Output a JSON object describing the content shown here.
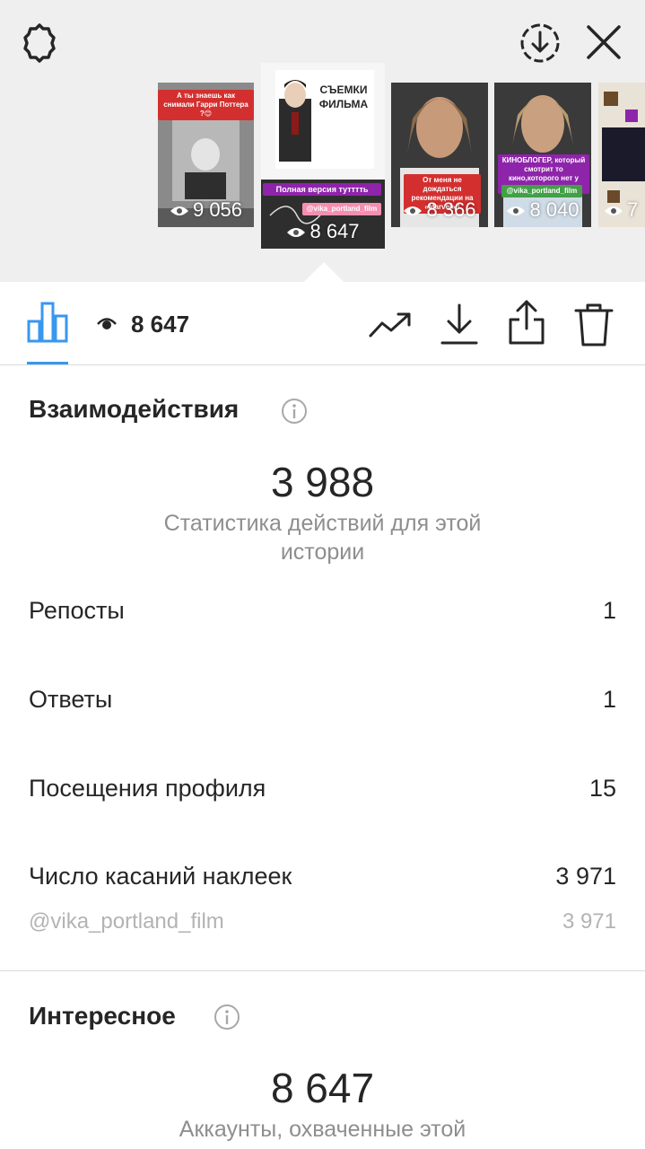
{
  "stories": [
    {
      "caption": "А ты знаешь как снимали Гарри Поттера ?😊",
      "views": "9 056"
    },
    {
      "title": "СЪЕМКИ ФИЛЬМА",
      "caption": "Полная версия тутттть",
      "tag": "@vika_portland_film",
      "views": "8 647",
      "selected": true
    },
    {
      "caption": "От меня не дождаться рекомендации на «Marvel» !",
      "views": "8 366"
    },
    {
      "caption": "КИНОБЛОГЕР, который смотрит то кино,которого нет у меня.",
      "tag": "@vika_portland_film",
      "views": "8 040"
    },
    {
      "views": "7"
    }
  ],
  "toolbar": {
    "views": "8 647"
  },
  "interactions": {
    "title": "Взаимодействия",
    "total": "3 988",
    "subtitle": "Статистика действий для этой истории",
    "rows": [
      {
        "label": "Репосты",
        "value": "1"
      },
      {
        "label": "Ответы",
        "value": "1"
      },
      {
        "label": "Посещения профиля",
        "value": "15"
      },
      {
        "label": "Число касаний наклеек",
        "value": "3 971"
      }
    ],
    "sticker": {
      "label": "@vika_portland_film",
      "value": "3 971"
    }
  },
  "discovery": {
    "title": "Интересное",
    "total": "8 647",
    "subtitle": "Аккаунты, охваченные этой"
  },
  "colors": {
    "accent": "#3897f0",
    "text": "#262626",
    "muted": "#8e8e8e",
    "top_bg": "#efefef"
  }
}
